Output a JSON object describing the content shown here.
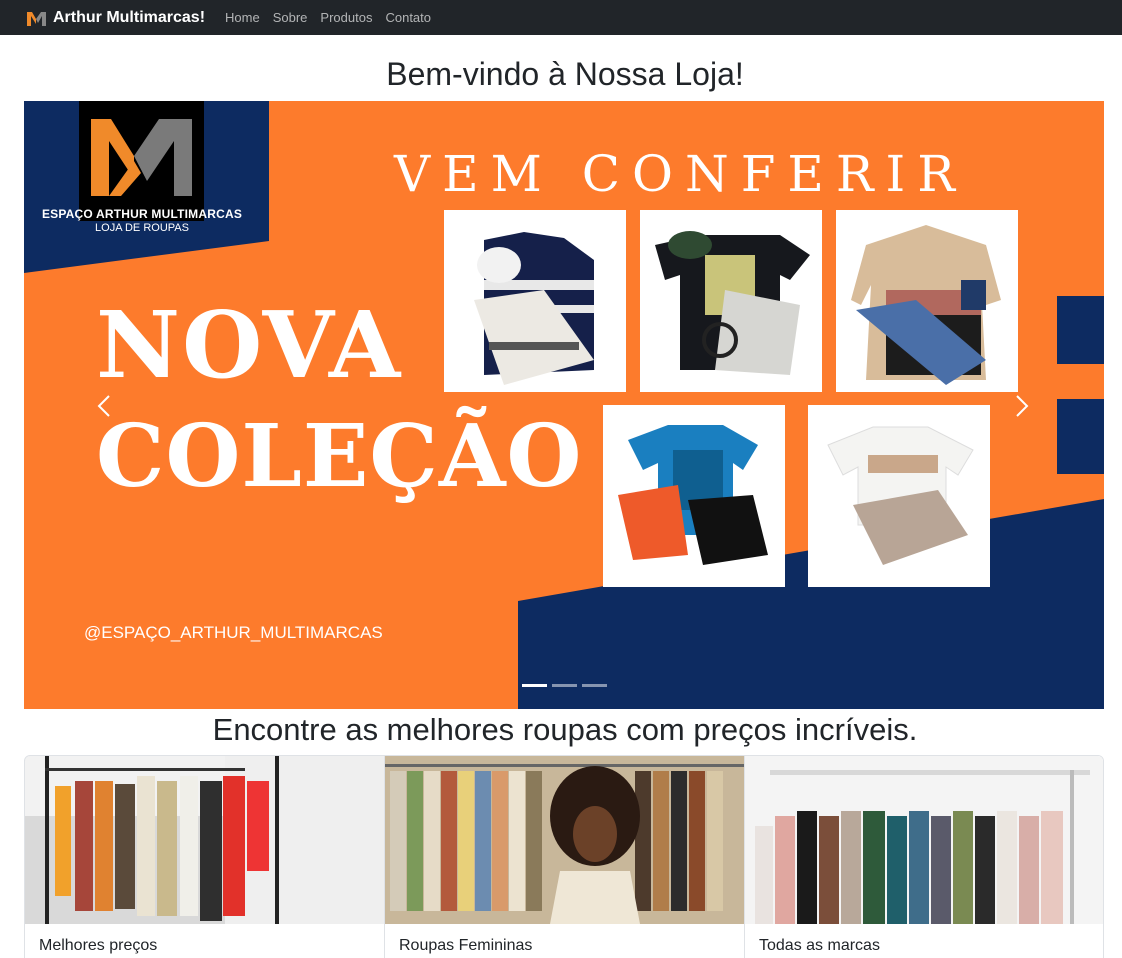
{
  "navbar": {
    "brand": "Arthur Multimarcas!",
    "links": [
      "Home",
      "Sobre",
      "Produtos",
      "Contato"
    ]
  },
  "page": {
    "welcome": "Bem-vindo à Nossa Loja!",
    "subtitle": "Encontre as melhores roupas com preços incríveis."
  },
  "banner": {
    "logo_name": "ESPAÇO ARTHUR MULTIMARCAS",
    "logo_sub": "LOJA DE ROUPAS",
    "headline_top": "VEM CONFERIR",
    "headline_line1": "NOVA",
    "headline_line2": "COLEÇÃO",
    "handle": "@ESPAÇO_ARTHUR_MULTIMARCAS",
    "indicators": [
      true,
      false,
      false
    ]
  },
  "cards": [
    {
      "title": "Melhores preços"
    },
    {
      "title": "Roupas Femininas"
    },
    {
      "title": "Todas as marcas"
    }
  ],
  "colors": {
    "navbar": "#212529",
    "banner_orange": "#fd7b2c",
    "banner_navy": "#0d2b61"
  }
}
